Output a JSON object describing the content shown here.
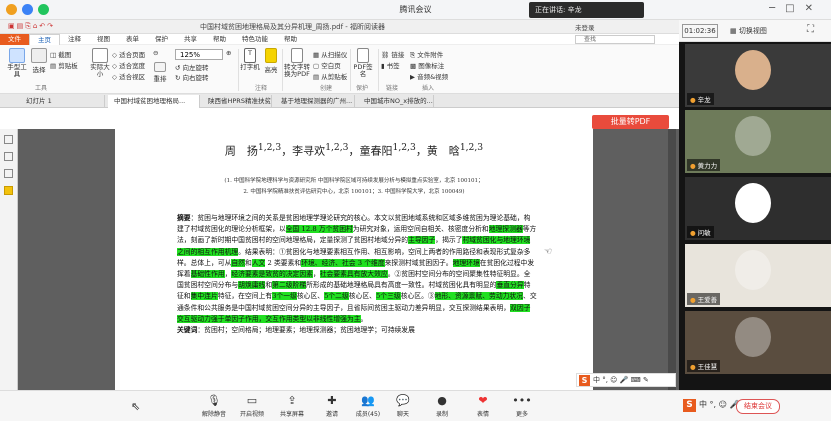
{
  "meeting": {
    "app_title": "腾讯会议",
    "speaking_label": "正在讲话: 辛龙",
    "timer": "01:02:36",
    "view_switch": "切换视图"
  },
  "acrobat": {
    "doc_title": "中国村域贫困地理格局及其分异机理_周扬.pdf - 福昕阅读器",
    "login": "未登录",
    "menus": [
      "文件",
      "主页",
      "注释",
      "视图",
      "表单",
      "保护",
      "共享",
      "帮助",
      "特色功能",
      "帮助"
    ],
    "active_menu": "主页",
    "search_placeholder": "查找",
    "ribbon": {
      "hand_tool": "手型工具",
      "select": "选择",
      "snapshot": "截图",
      "clipboard": "剪贴板",
      "fit_page": "实际大小",
      "fit_width": "适合页面",
      "fit_height": "适合宽度",
      "fit_visible": "适合视区",
      "zoom_value": "125%",
      "reflow": "重排",
      "rotate_left": "向左旋转",
      "rotate_right": "向右旋转",
      "typewriter": "打字机",
      "highlight": "高亮",
      "convert": "转文字转换为PDF",
      "from_scanner": "从扫描仪",
      "blank": "空白页",
      "from_clipboard": "从剪贴板",
      "pdf_sign": "PDF签名",
      "link": "链接",
      "bookmark": "书签",
      "file_attach": "文件附件",
      "image_annot": "图像标注",
      "audio_video": "音频&视频",
      "group_tools": "工具",
      "group_comment": "注释",
      "group_create": "创建",
      "group_protect": "保护",
      "group_links": "链接",
      "group_insert": "插入"
    },
    "tabs": [
      "幻灯片 1",
      "中国村域贫困地理格局...",
      "陕西省HPRS精准扶贫...",
      "基于地理探测器的广州...",
      "中国城市NO_x排放的..."
    ],
    "active_tab": 1,
    "batch_pdf": "批量转PDF"
  },
  "paper": {
    "authors_html": "周　扬<sup>1,2,3</sup>，李寻欢<sup>1,2,3</sup>，童春阳<sup>1,2,3</sup>，黄　晗<sup>1,2,3</sup>",
    "affil_1": "(1. 中国科学院地理科学与资源研究所 中国科学院区域可持续发展分析与模拟重点实验室，北京 100101；",
    "affil_2": "2. 中国科学院精准扶贫评估研究中心，北京 100101；3. 中国科学院大学，北京 100049)",
    "abstract_html": "<b>摘要</b>：贫困与地理环境之间的关系是贫困地理学理论研究的核心。本文以贫困地域系统和区域多维贫困为理论基础，构建了村域贫困化的理论分析框架，以<span class=\"hl\">全国 12.8 万个贫困村</span>为研究对象，运用空间自相关、核密度分析和<span class=\"hl\">地理探测器</span>等方法，刻画了新时期中国贫困村的空间地理格局，定量探测了贫困村地域分异的<span class=\"hl\">主导因子</span>，揭示了<span class=\"hl\">村域贫困化与地理环境之间的相互作用机理</span>。结果表明：①贫困化与地理要素相互作用、相互影响，空间上两者的作用路径和表现形式复杂多样。总体上，可从<span class=\"hl\">自然</span>和<span class=\"hl\">人文</span> 2 类要素和<span class=\"hl\">环境、经济、社会 3 个维度</span>来探测村域贫困因子。<span class=\"hl\">地理环境</span>在贫困化过程中发挥着<span class=\"hl\">基础性作用</span>，<span class=\"hl\">经济要素是致贫的决定因素</span>，<span class=\"hl\">社会要素具有放大效应</span>。②贫困村空间分布的空间聚集性特征明显。全国贫困村空间分布与<span class=\"hl\">胡焕庸线</span>和<span class=\"hl\">第二级阶梯</span>所形成的基础地理格局具有高度一致性。村域贫困化具有明显的<span class=\"hl\">垂直分异</span>特征和<span class=\"hl\">集中连片</span>特征，在空间上有<span class=\"hl\">3个一级</span>核心区、<span class=\"hl\">5个二级</span>核心区、<span class=\"hl\">5个三级</span>核心区。③<span class=\"hl\">地形、资源禀赋、劳动力状况</span>、交通条件和公共服务是中国村域贫困空间分异的主导因子，且省际间贫困主驱动力差异明显，交互探测结果表明，<span class=\"hl\">双因子交互驱动力强于单因子作用，交互作用类型以非线性增强为主</span>。<br><b>关键词</b>：贫困村；空间格局；地理要素；地理探测器；贫困地理学；可持续发展"
  },
  "participants": [
    {
      "name": "辛龙"
    },
    {
      "name": "黄力力"
    },
    {
      "name": "问敏"
    },
    {
      "name": "王爱善"
    },
    {
      "name": "王佳慧"
    }
  ],
  "toolbar": {
    "mute": "解除静音",
    "video": "开启视频",
    "share": "共享屏幕",
    "invite": "邀请",
    "members": "成员(45)",
    "chat": "聊天",
    "record": "录制",
    "reactions": "表情",
    "more": "更多",
    "end": "结束会议"
  },
  "ime_chars": "中 °, ☺ 🎤 ⌨ ✎"
}
